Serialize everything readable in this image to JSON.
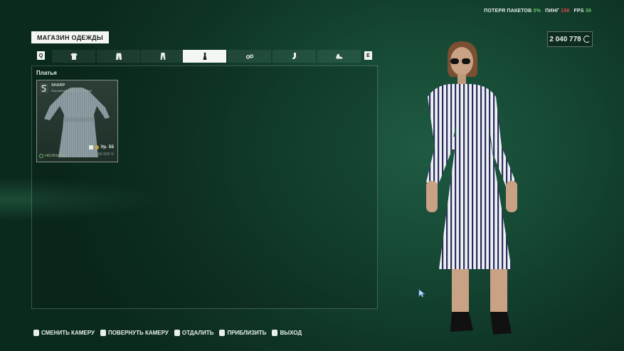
{
  "stats": {
    "packet_loss_label": "ПОТЕРЯ ПАКЕТОВ",
    "packet_loss_value": "0%",
    "ping_label": "ПИНГ",
    "ping_value": "158",
    "fps_label": "FPS",
    "fps_value": "39"
  },
  "currency": {
    "amount": "2 040 778"
  },
  "shop": {
    "title": "МАГАЗИН ОДЕЖДЫ"
  },
  "tabs": {
    "prev_key": "Q",
    "next_key": "E",
    "items": [
      {
        "icon": "tshirt-icon"
      },
      {
        "icon": "jacket-icon"
      },
      {
        "icon": "pants-icon"
      },
      {
        "icon": "dress-icon",
        "active": true
      },
      {
        "icon": "glasses-icon"
      },
      {
        "icon": "socks-icon"
      },
      {
        "icon": "shoes-icon"
      }
    ]
  },
  "section": {
    "title": "Платья"
  },
  "item": {
    "brand": "SHARP",
    "description": "башмачное платье с синим",
    "level": "Ур. 55",
    "price": "100 000",
    "rarity": "НЕОБЫЧН."
  },
  "hints": [
    {
      "label": "СМЕНИТЬ КАМЕРУ"
    },
    {
      "label": "ПОВЕРНУТЬ КАМЕРУ"
    },
    {
      "label": "ОТДАЛИТЬ"
    },
    {
      "label": "ПРИБЛИЗИТЬ"
    },
    {
      "label": "ВЫХОД"
    }
  ],
  "colors": {
    "accent": "#f4f6f4",
    "ping": "#e14a4a",
    "fps": "#6ec86a",
    "background": "#164a35"
  }
}
